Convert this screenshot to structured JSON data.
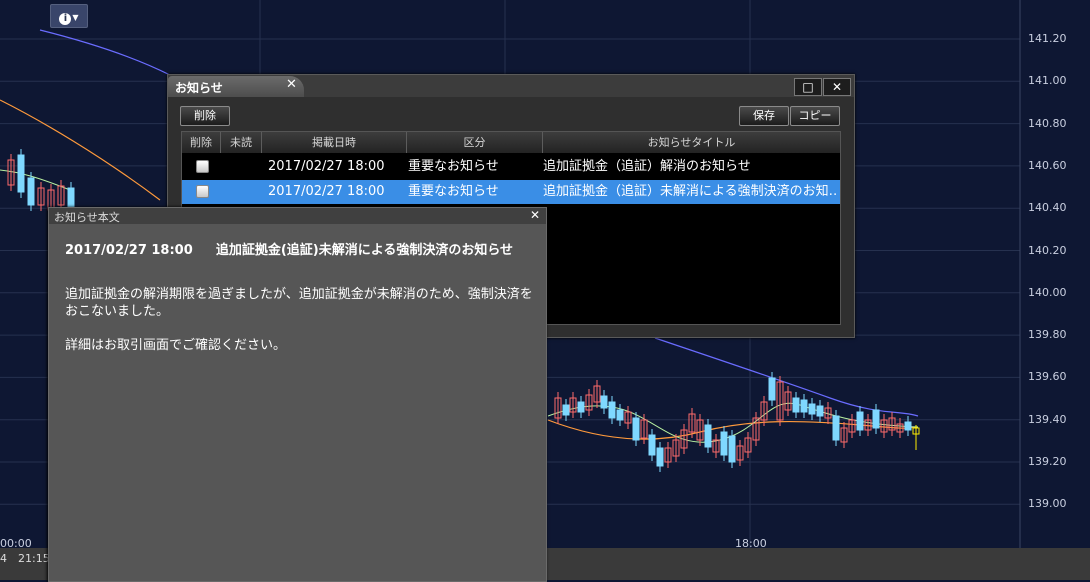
{
  "chart": {
    "info_button": "i",
    "y_axis_labels": [
      "141.20",
      "141.00",
      "140.80",
      "140.60",
      "140.40",
      "140.20",
      "140.00",
      "139.80",
      "139.60",
      "139.40",
      "139.20",
      "139.00"
    ],
    "time_labels": [
      "00:00",
      "21:15",
      "18:00"
    ],
    "time_left_fragment": "4",
    "colors": {
      "background": "#0e1733",
      "grid": "#26314f",
      "bull": "#ff6b6b",
      "bear": "#7fd8ff",
      "ma_short": "#b8f0a0",
      "ma_mid": "#ff9a3c",
      "ma_long": "#6a6cff",
      "current": "#ffee00"
    }
  },
  "notice_window": {
    "title": "お知らせ",
    "tab_close": "✕",
    "maximize_icon": "□",
    "close_icon": "✕",
    "delete_button": "削除",
    "save_button": "保存",
    "copy_button": "コピー",
    "columns": [
      "削除",
      "未読",
      "掲載日時",
      "区分",
      "お知らせタイトル"
    ],
    "rows": [
      {
        "date": "2017/02/27 18:00",
        "category": "重要なお知らせ",
        "title": "追加証拠金（追証）解消のお知らせ",
        "selected": false
      },
      {
        "date": "2017/02/27 18:00",
        "category": "重要なお知らせ",
        "title": "追加証拠金（追証）未解消による強制決済のお知…",
        "selected": true
      }
    ]
  },
  "detail_window": {
    "title": "お知らせ本文",
    "close_icon": "✕",
    "date": "2017/02/27 18:00",
    "heading": "追加証拠金(追証)未解消による強制決済のお知らせ",
    "body_line1": "追加証拠金の解消期限を過ぎましたが、追加証拠金が未解消のため、強制決済をおこないました。",
    "body_line2": "詳細はお取引画面でご確認ください。"
  }
}
